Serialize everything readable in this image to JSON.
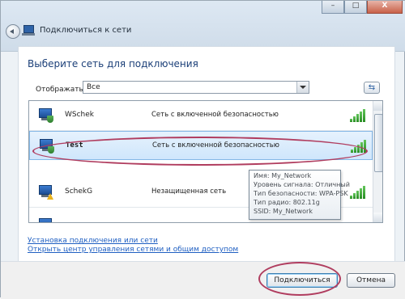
{
  "window": {
    "title": "Подключиться к сети",
    "buttons": {
      "minimize": "–",
      "maximize": "□",
      "close": "X"
    }
  },
  "main": {
    "heading": "Выберите сеть для подключения",
    "filter": {
      "label": "Отображать",
      "selected": "Все"
    },
    "refresh_glyph": "⇆"
  },
  "networks": [
    {
      "name": "WSchek",
      "security": "Сеть с включенной безопасностью",
      "secured": true,
      "signal_bars": 5,
      "selected": false
    },
    {
      "name": "Test",
      "security": "Сеть с включенной безопасностью",
      "secured": true,
      "signal_bars": 5,
      "selected": true
    },
    {
      "name": "SchekG",
      "security": "Незащищенная сеть",
      "secured": false,
      "signal_bars": 5,
      "selected": false
    }
  ],
  "tooltip": {
    "line1": "Имя: My_Network",
    "line2": "Уровень сигнала: Отличный",
    "line3": "Тип безопасности: WPA-PSK",
    "line4": "Тип радио: 802.11g",
    "line5": "SSID: My_Network"
  },
  "links": {
    "setup": "Установка подключения или сети",
    "center": "Открыть центр управления сетями и общим доступом"
  },
  "buttons": {
    "connect": "Подключиться",
    "cancel": "Отмена"
  },
  "colors": {
    "link": "#1f5fc2",
    "heading": "#1b3f78",
    "annotation": "#b03d5f",
    "signal": "#278d22"
  }
}
